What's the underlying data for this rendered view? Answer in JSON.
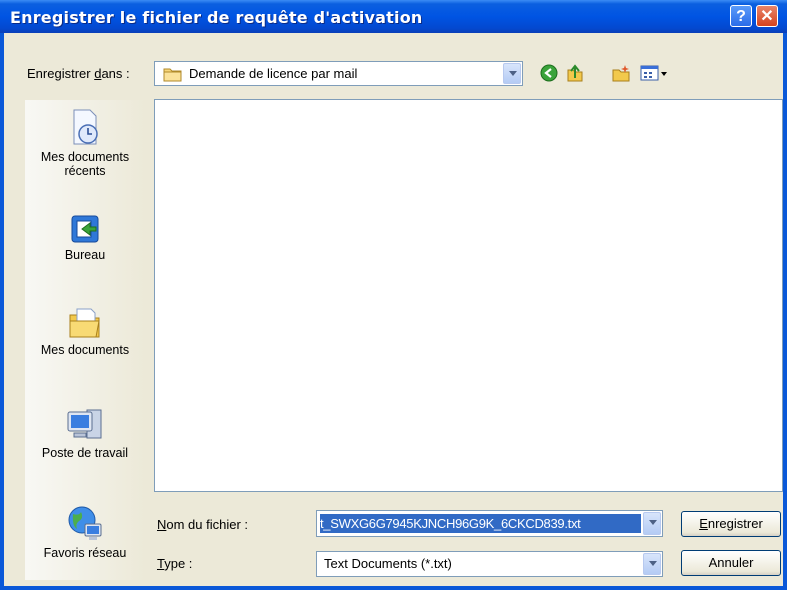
{
  "window": {
    "title": "Enregistrer le fichier de requête d'activation",
    "help_label": "?",
    "close_label": "✕"
  },
  "toolbar": {
    "save_in_prefix": "Enregistrer ",
    "save_in_accel": "d",
    "save_in_suffix": "ans :",
    "folder_value": "Demande de licence par mail"
  },
  "places": [
    {
      "label_line1": "Mes documents",
      "label_line2": "récents",
      "icon": "recent-documents-icon"
    },
    {
      "label_line1": "Bureau",
      "label_line2": "",
      "icon": "desktop-icon"
    },
    {
      "label_line1": "Mes documents",
      "label_line2": "",
      "icon": "my-documents-icon"
    },
    {
      "label_line1": "Poste de travail",
      "label_line2": "",
      "icon": "my-computer-icon"
    },
    {
      "label_line1": "Favoris réseau",
      "label_line2": "",
      "icon": "network-places-icon"
    }
  ],
  "form": {
    "filename_accel": "N",
    "filename_rest": "om du fichier :",
    "filename_value": "t_SWXG6G7945KJNCH96G9K_6CKCD839.txt",
    "type_accel": "T",
    "type_rest": "ype :",
    "type_value": "Text Documents (*.txt)"
  },
  "buttons": {
    "save_accel": "E",
    "save_rest": "nregistrer",
    "cancel_label": "Annuler"
  },
  "colors": {
    "titlebar": "#0054e3",
    "selection": "#316ac5",
    "dialog_bg": "#ece9d8"
  }
}
